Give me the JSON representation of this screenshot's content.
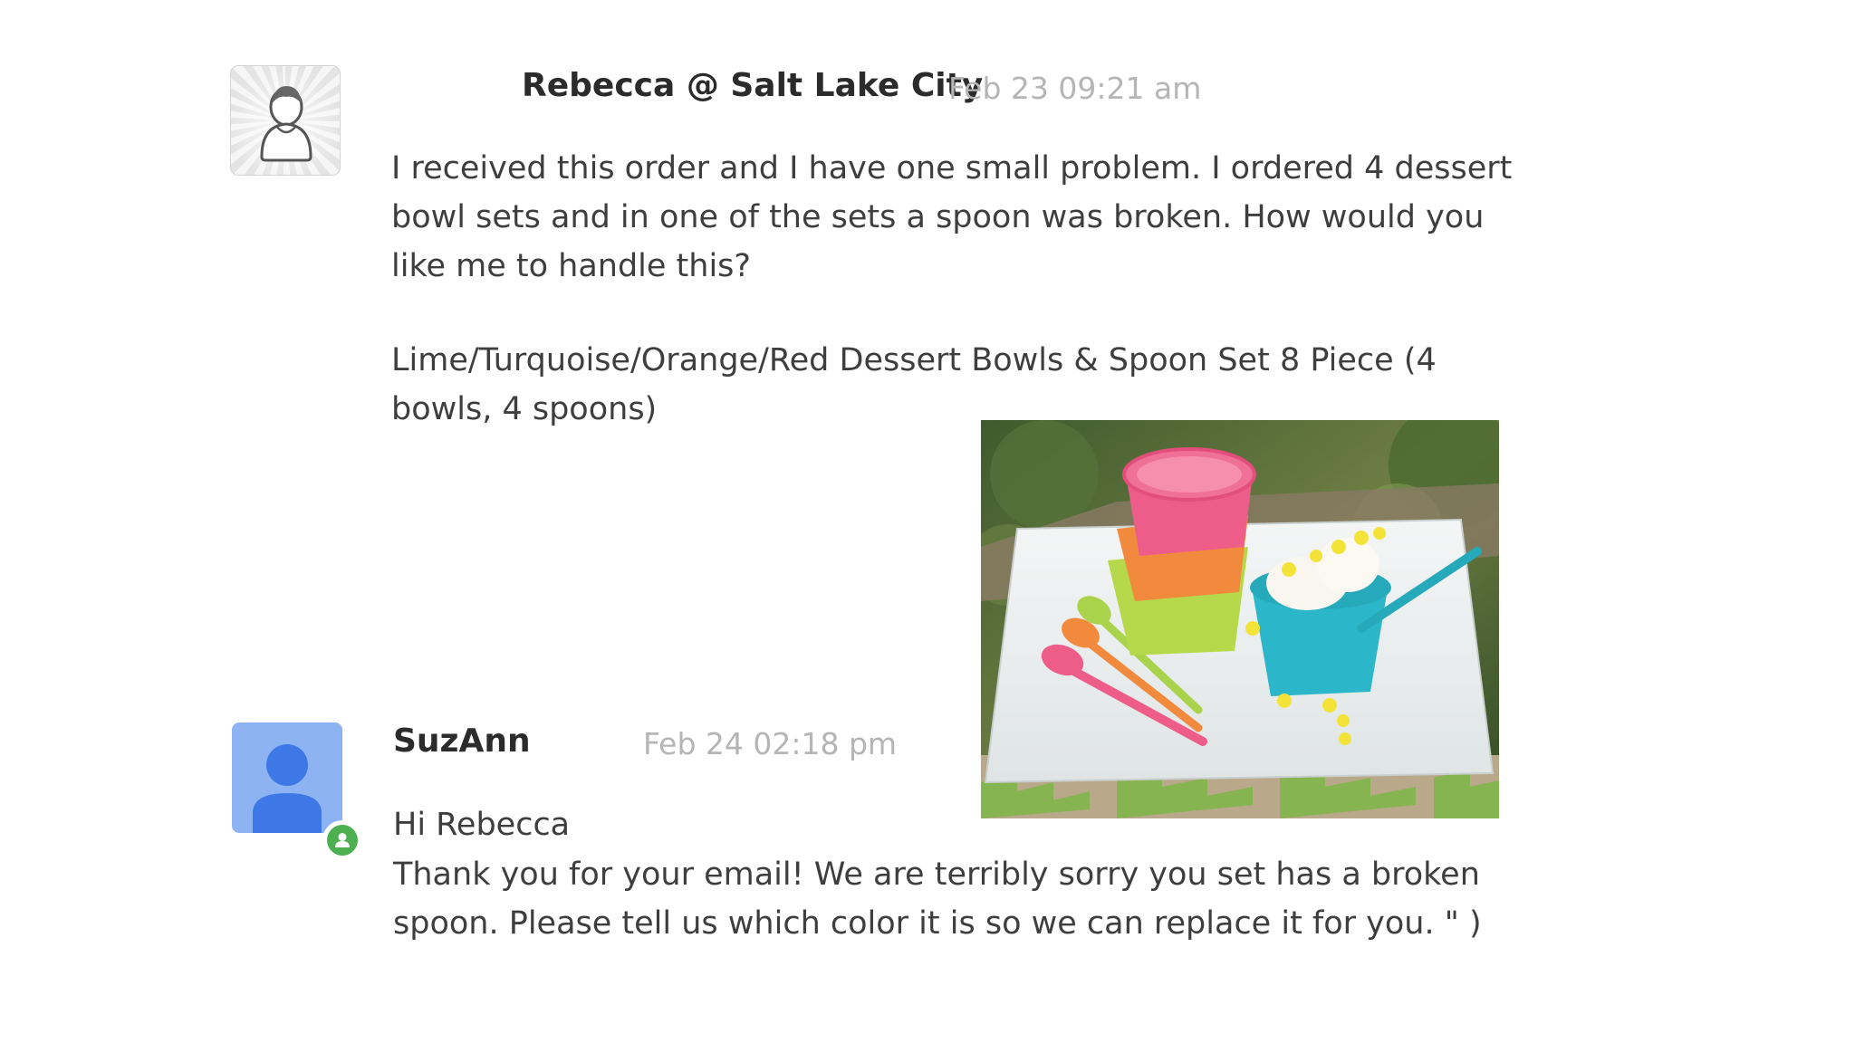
{
  "messages": [
    {
      "author": "Rebecca @ Salt Lake City",
      "timestamp": "Feb 23 09:21 am",
      "avatar_icon": "generic-user-icon",
      "paragraphs": [
        "I received this order and I have one small problem. I ordered 4 dessert bowl sets and in one of the sets a spoon was broken. How would you like me to handle this?",
        "Lime/Turquoise/Orange/Red Dessert Bowls & Spoon Set 8 Piece (4 bowls, 4 spoons)"
      ],
      "attachment_icon": "dessert-bowls-photo"
    },
    {
      "author": "SuzAnn",
      "timestamp": "Feb 24 02:18 pm",
      "avatar_icon": "person-icon",
      "status_icon": "online-status-icon",
      "greeting": "Hi Rebecca",
      "body": "Thank you for your email! We are terribly sorry you set has a broken spoon. Please tell us which color it is so we can replace it for you. \" )"
    }
  ],
  "colors": {
    "timestamp": "#b5b5b5",
    "author": "#2b2b2b",
    "body": "#3e3e3e",
    "avatar_blue": "#8db3f3",
    "status_green": "#4caf50"
  }
}
